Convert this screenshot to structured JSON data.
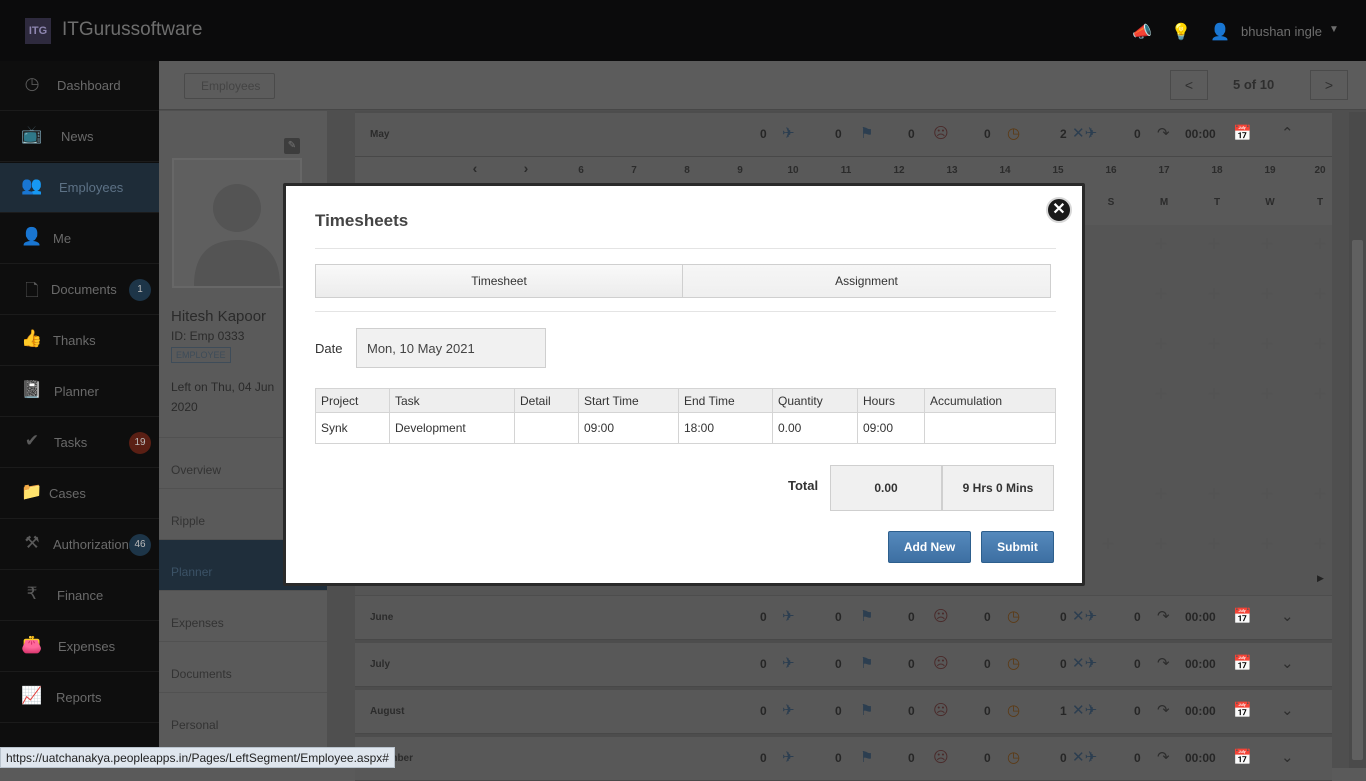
{
  "app": {
    "logo_text": "ITG",
    "brand": "ITGurussoftware"
  },
  "topbar": {
    "username": "bhushan ingle",
    "icons": [
      "megaphone-icon",
      "lightbulb-icon",
      "user-icon",
      "caret-down-icon"
    ]
  },
  "sidebar": {
    "items": [
      {
        "label": "Dashboard",
        "icon": "dashboard-icon"
      },
      {
        "label": "News",
        "icon": "tv-icon"
      },
      {
        "label": "Employees",
        "icon": "users-icon",
        "active": true
      },
      {
        "label": "Me",
        "icon": "user-star-icon"
      },
      {
        "label": "Documents",
        "icon": "document-icon",
        "badge": "1"
      },
      {
        "label": "Thanks",
        "icon": "thumbs-up-icon"
      },
      {
        "label": "Planner",
        "icon": "planner-icon"
      },
      {
        "label": "Tasks",
        "icon": "check-icon",
        "badge": "19"
      },
      {
        "label": "Cases",
        "icon": "folder-icon"
      },
      {
        "label": "Authorizations",
        "icon": "gavel-icon",
        "badge": "46"
      },
      {
        "label": "Finance",
        "icon": "rupee-icon"
      },
      {
        "label": "Expenses",
        "icon": "wallet-icon"
      },
      {
        "label": "Reports",
        "icon": "chart-icon"
      }
    ]
  },
  "breadcrumb": {
    "label": "Employees"
  },
  "pager": {
    "prev": "<",
    "count": "5 of 10",
    "next": ">"
  },
  "profile": {
    "name": "Hitesh Kapoor",
    "id": "ID: Emp 0333",
    "badge": "EMPLOYEE",
    "left_on": "Left on Thu, 04 Jun 2020",
    "menu": [
      "Overview",
      "Ripple",
      "Planner",
      "Expenses",
      "Documents",
      "Personal"
    ],
    "active_menu": "Planner"
  },
  "planner": {
    "months": [
      {
        "name": "May",
        "stats": [
          "0",
          "0",
          "0",
          "0",
          "2",
          "0"
        ],
        "time": "00:00"
      },
      {
        "name": "June",
        "stats": [
          "0",
          "0",
          "0",
          "0",
          "0",
          "0"
        ],
        "time": "00:00"
      },
      {
        "name": "July",
        "stats": [
          "0",
          "0",
          "0",
          "0",
          "0",
          "0"
        ],
        "time": "00:00"
      },
      {
        "name": "August",
        "stats": [
          "0",
          "0",
          "0",
          "0",
          "1",
          "0"
        ],
        "time": "00:00"
      },
      {
        "name": "ember",
        "stats": [
          "0",
          "0",
          "0",
          "0",
          "0",
          "0"
        ],
        "time": "00:00"
      }
    ],
    "day_numbers": [
      "6",
      "7",
      "8",
      "9",
      "10",
      "11",
      "12",
      "13",
      "14",
      "15",
      "16",
      "17",
      "18",
      "19",
      "20"
    ],
    "day_letters": [
      "S",
      "M",
      "T",
      "W",
      "T"
    ]
  },
  "status_url": "https://uatchanakya.peopleapps.in/Pages/LeftSegment/Employee.aspx#",
  "modal": {
    "title": "Timesheets",
    "tabs": [
      "Timesheet",
      "Assignment"
    ],
    "date_label": "Date",
    "date_value": "Mon, 10 May 2021",
    "columns": [
      "Project",
      "Task",
      "Detail",
      "Start Time",
      "End Time",
      "Quantity",
      "Hours",
      "Accumulation"
    ],
    "rows": [
      {
        "project": "Synk",
        "task": "Development",
        "detail": "",
        "start": "09:00",
        "end": "18:00",
        "quantity": "0.00",
        "hours": "09:00",
        "accumulation": ""
      }
    ],
    "total_label": "Total",
    "total_quantity": "0.00",
    "total_hours": "9 Hrs 0 Mins",
    "add_new": "Add New",
    "submit": "Submit"
  }
}
